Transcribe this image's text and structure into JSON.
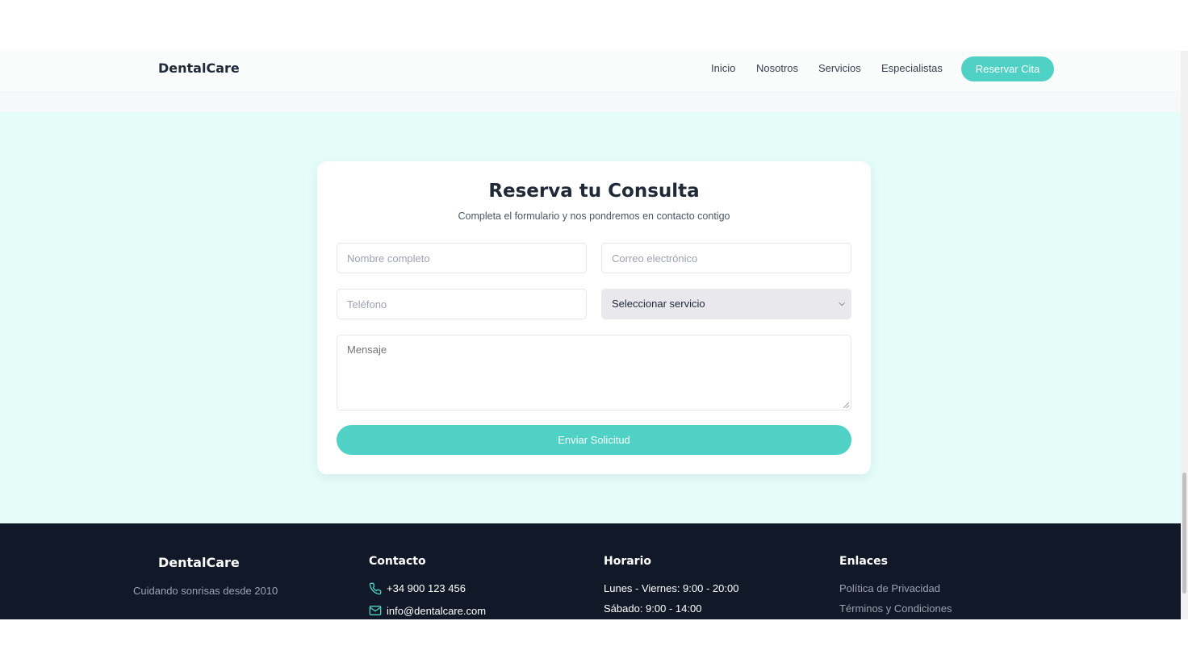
{
  "header": {
    "brand": "DentalCare",
    "nav": [
      "Inicio",
      "Nosotros",
      "Servicios",
      "Especialistas"
    ],
    "cta_label": "Reservar Cita"
  },
  "form": {
    "title": "Reserva tu Consulta",
    "subtitle": "Completa el formulario y nos pondremos en contacto contigo",
    "name_placeholder": "Nombre completo",
    "email_placeholder": "Correo electrónico",
    "phone_placeholder": "Teléfono",
    "service_selected": "Seleccionar servicio",
    "message_placeholder": "Mensaje",
    "submit_label": "Enviar Solicitud"
  },
  "footer": {
    "brand": "DentalCare",
    "tagline": "Cuidando sonrisas desde 2010",
    "contact": {
      "heading": "Contacto",
      "phone": "+34 900 123 456",
      "email": "info@dentalcare.com"
    },
    "hours": {
      "heading": "Horario",
      "weekdays": "Lunes - Viernes: 9:00 - 20:00",
      "saturday": "Sábado: 9:00 - 14:00"
    },
    "links": {
      "heading": "Enlaces",
      "items": [
        "Política de Privacidad",
        "Términos y Condiciones"
      ]
    }
  },
  "colors": {
    "accent": "#4fd1c5",
    "section_bg": "#e4fdf8",
    "footer_bg": "#111827"
  },
  "icons": [
    "phone-icon",
    "mail-icon",
    "chevron-down-icon"
  ]
}
